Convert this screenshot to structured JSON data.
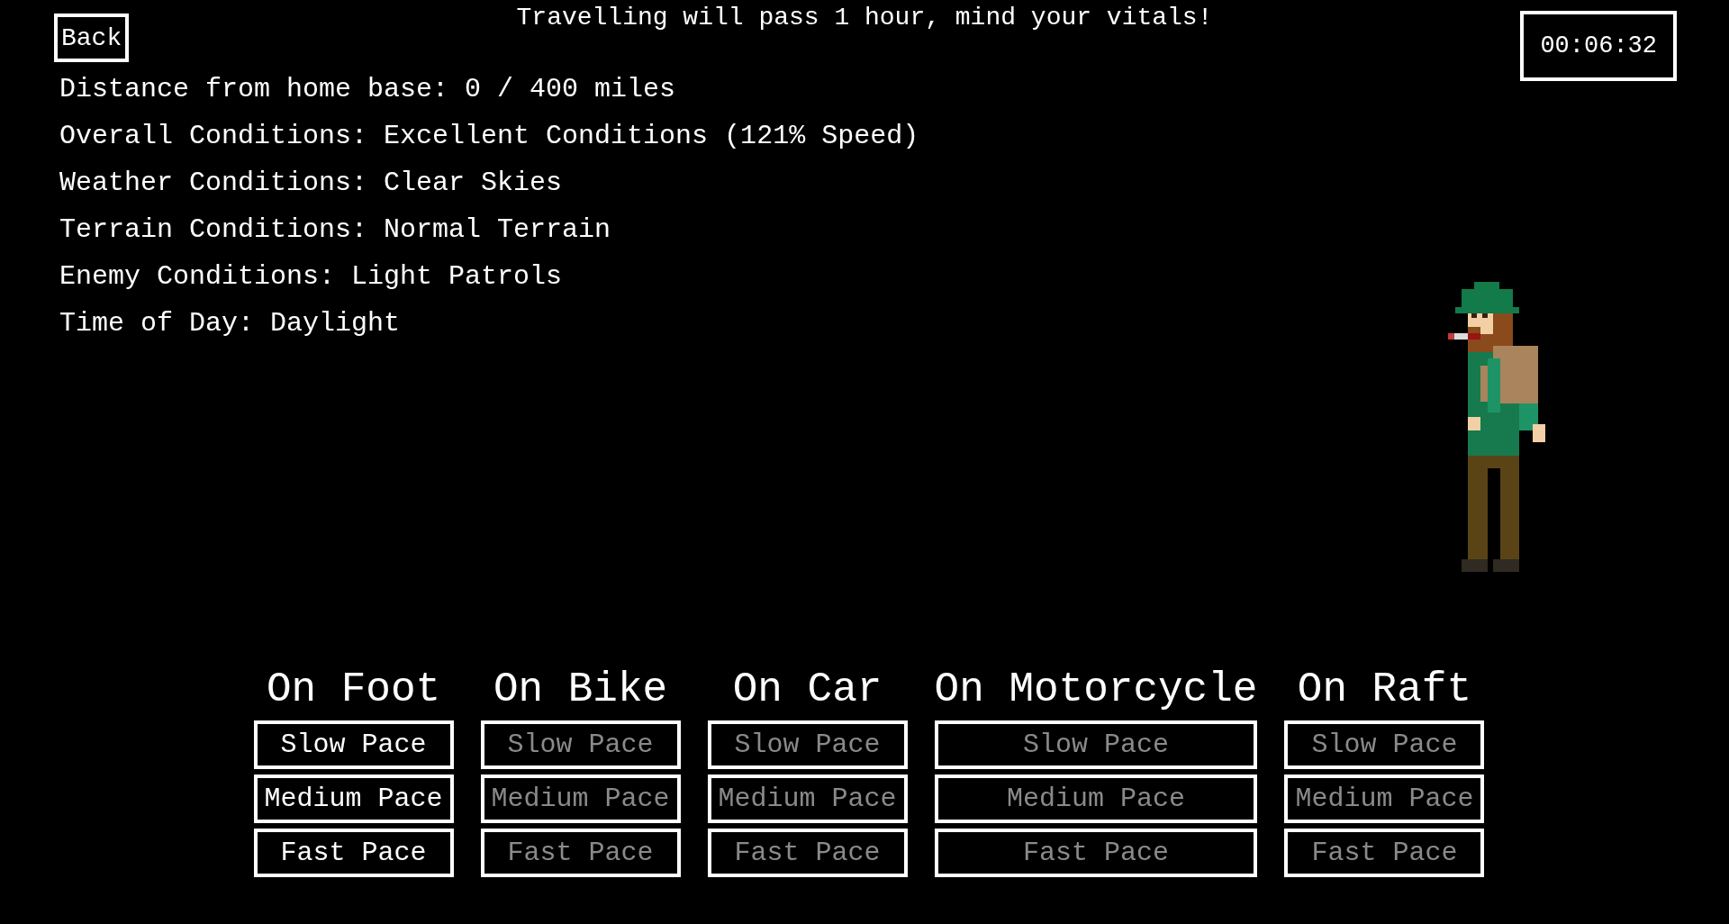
{
  "back_button": "Back",
  "notice": "Travelling will pass 1 hour, mind your vitals!",
  "timer": "00:06:32",
  "conditions": [
    {
      "label": "Distance from home base:",
      "value": "0 / 400 miles"
    },
    {
      "label": "Overall Conditions:",
      "value": "Excellent Conditions (121% Speed)"
    },
    {
      "label": "Weather Conditions:",
      "value": "Clear Skies"
    },
    {
      "label": "Terrain Conditions:",
      "value": "Normal Terrain"
    },
    {
      "label": "Enemy Conditions:",
      "value": "Light Patrols"
    },
    {
      "label": "Time of Day:",
      "value": "Daylight"
    }
  ],
  "travel_modes": [
    {
      "name": "On Foot",
      "paces": [
        {
          "label": "Slow Pace",
          "disabled": false
        },
        {
          "label": "Medium Pace",
          "disabled": false
        },
        {
          "label": "Fast Pace",
          "disabled": false
        }
      ]
    },
    {
      "name": "On Bike",
      "paces": [
        {
          "label": "Slow Pace",
          "disabled": true
        },
        {
          "label": "Medium Pace",
          "disabled": true
        },
        {
          "label": "Fast Pace",
          "disabled": true
        }
      ]
    },
    {
      "name": "On Car",
      "paces": [
        {
          "label": "Slow Pace",
          "disabled": true
        },
        {
          "label": "Medium Pace",
          "disabled": true
        },
        {
          "label": "Fast Pace",
          "disabled": true
        }
      ]
    },
    {
      "name": "On Motorcycle",
      "paces": [
        {
          "label": "Slow Pace",
          "disabled": true
        },
        {
          "label": "Medium Pace",
          "disabled": true
        },
        {
          "label": "Fast Pace",
          "disabled": true
        }
      ]
    },
    {
      "name": "On Raft",
      "paces": [
        {
          "label": "Slow Pace",
          "disabled": true
        },
        {
          "label": "Medium Pace",
          "disabled": true
        },
        {
          "label": "Fast Pace",
          "disabled": true
        }
      ]
    }
  ]
}
